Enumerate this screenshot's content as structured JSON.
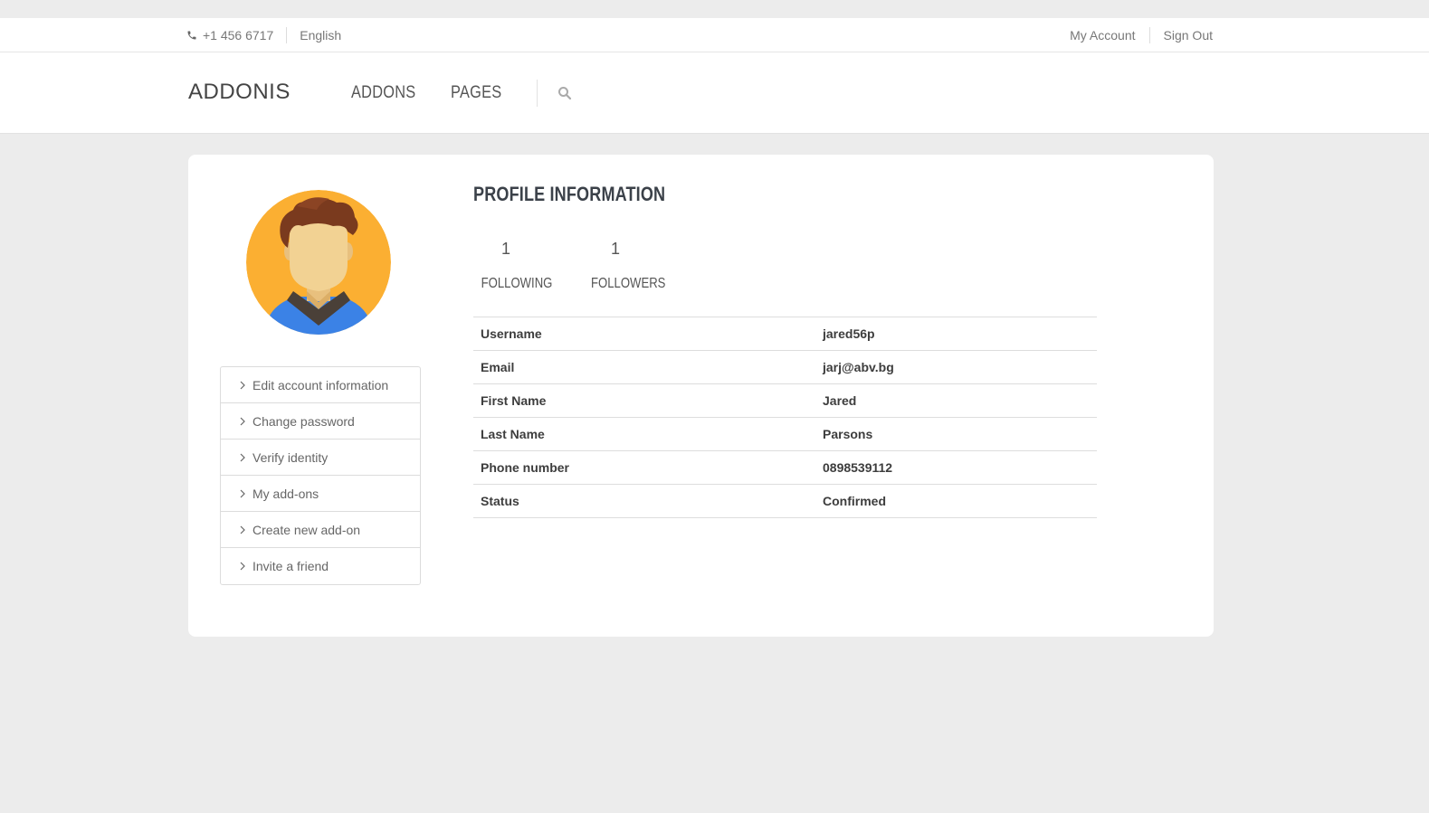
{
  "topbar": {
    "phone": "+1 456 6717",
    "language": "English",
    "my_account": "My Account",
    "sign_out": "Sign Out"
  },
  "header": {
    "brand": "ADDONIS",
    "nav": [
      "ADDONS",
      "PAGES"
    ]
  },
  "sidebar": {
    "items": [
      {
        "label": "Edit account information"
      },
      {
        "label": "Change password"
      },
      {
        "label": "Verify identity"
      },
      {
        "label": "My add-ons"
      },
      {
        "label": "Create new add-on"
      },
      {
        "label": "Invite a friend"
      }
    ]
  },
  "profile": {
    "title": "PROFILE INFORMATION",
    "following_count": "1",
    "following_label": "FOLLOWING",
    "followers_count": "1",
    "followers_label": "FOLLOWERS",
    "rows": [
      {
        "key": "Username",
        "value": "jared56p"
      },
      {
        "key": "Email",
        "value": "jarj@abv.bg"
      },
      {
        "key": "First Name",
        "value": "Jared"
      },
      {
        "key": "Last Name",
        "value": "Parsons"
      },
      {
        "key": "Phone number",
        "value": "0898539112"
      },
      {
        "key": "Status",
        "value": "Confirmed"
      }
    ]
  },
  "icons": {
    "phone": "phone-icon",
    "search": "search-icon",
    "chevron": "chevron-right-icon",
    "avatar": "avatar"
  },
  "colors": {
    "avatar_bg": "#FBAF32",
    "avatar_shirt": "#3B82E6",
    "hair": "#7A3A1E"
  }
}
